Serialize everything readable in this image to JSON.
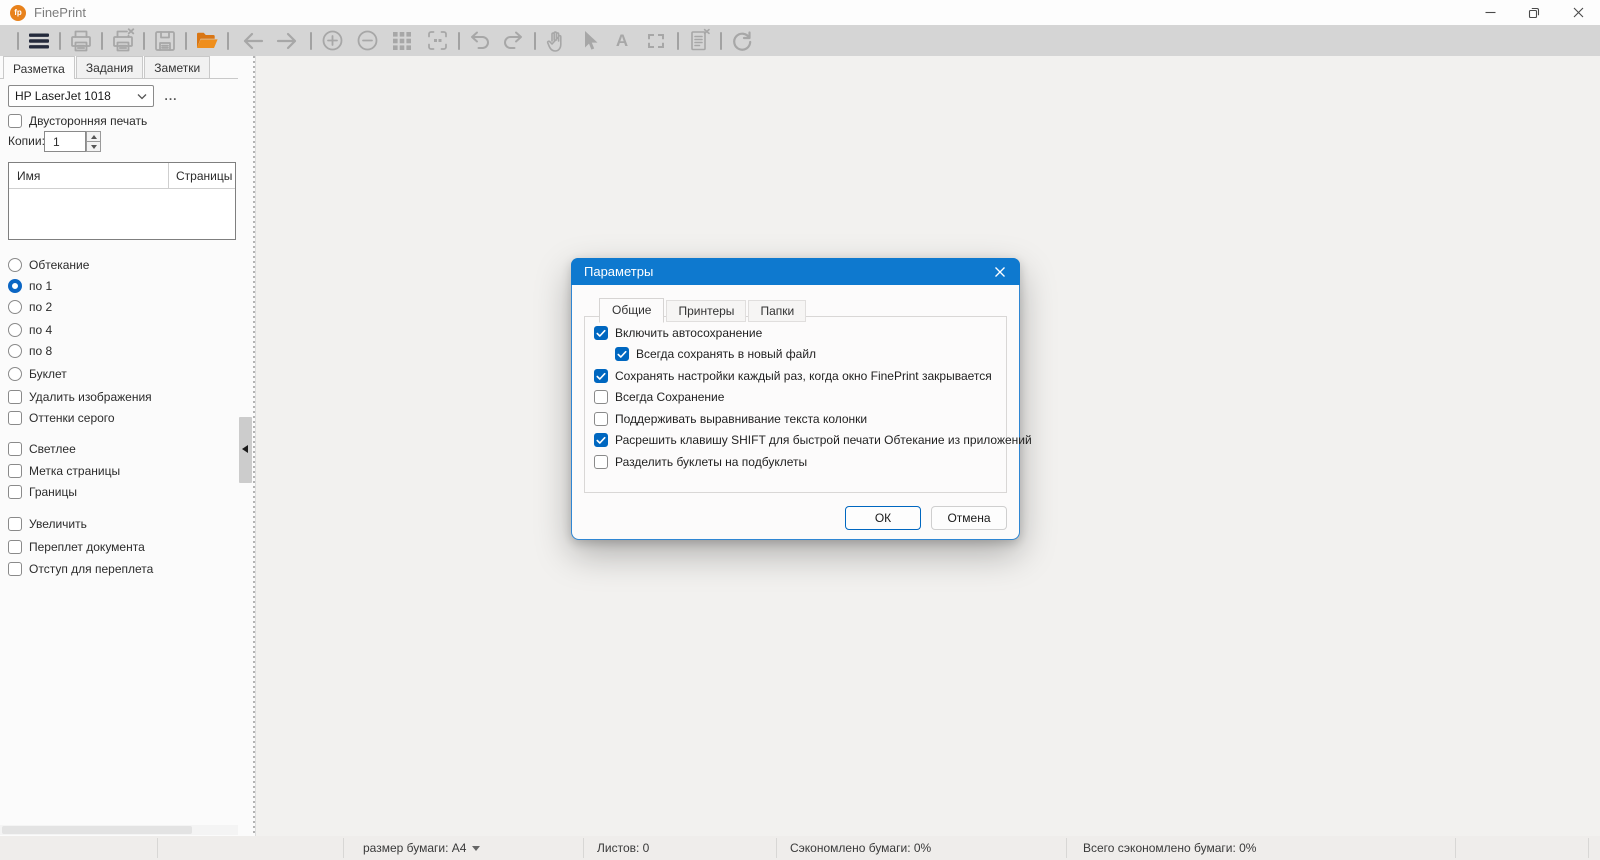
{
  "window": {
    "title": "FinePrint",
    "logo_text": "fp"
  },
  "toolbar": {
    "text_tool_glyph": "A",
    "icons": [
      "menu",
      "print",
      "delete-job",
      "save",
      "open-folder",
      "nav-back",
      "nav-forward",
      "zoom-in",
      "zoom-out",
      "grid-layout",
      "fit-page",
      "undo",
      "redo",
      "hand-pan",
      "cursor-select",
      "text-tool",
      "marquee-select",
      "notes",
      "refresh"
    ]
  },
  "sidebar": {
    "tabs": [
      {
        "label": "Разметка",
        "active": true
      },
      {
        "label": "Задания",
        "active": false
      },
      {
        "label": "Заметки",
        "active": false
      }
    ],
    "printer": {
      "value": "HP LaserJet 1018"
    },
    "more_label": "...",
    "duplex": {
      "label": "Двусторонняя печать",
      "checked": false
    },
    "copies": {
      "label": "Копии:",
      "value": "1"
    },
    "jobs": {
      "columns": [
        "Имя",
        "Страницы"
      ],
      "rows": []
    },
    "layout_options": [
      {
        "label": "Обтекание",
        "selected": false
      },
      {
        "label": "по 1",
        "selected": true
      },
      {
        "label": "по 2",
        "selected": false
      },
      {
        "label": "по 4",
        "selected": false
      },
      {
        "label": "по 8",
        "selected": false
      },
      {
        "label": "Буклет",
        "selected": false
      }
    ],
    "options": [
      {
        "label": "Удалить изображения",
        "checked": false
      },
      {
        "label": "Оттенки серого",
        "checked": false
      },
      {
        "label": "Светлее",
        "checked": false
      },
      {
        "label": "Метка страницы",
        "checked": false
      },
      {
        "label": "Границы",
        "checked": false
      },
      {
        "label": "Увеличить",
        "checked": false
      },
      {
        "label": "Переплет документа",
        "checked": false
      },
      {
        "label": "Отступ для переплета",
        "checked": false
      }
    ]
  },
  "dialog": {
    "title": "Параметры",
    "tabs": [
      {
        "label": "Общие",
        "active": true
      },
      {
        "label": "Принтеры",
        "active": false
      },
      {
        "label": "Папки",
        "active": false
      }
    ],
    "options": [
      {
        "label": "Включить автосохранение",
        "checked": true,
        "indent": 0
      },
      {
        "label": "Всегда сохранять в новый файл",
        "checked": true,
        "indent": 1
      },
      {
        "label": "Сохранять настройки каждый раз, когда окно FinePrint закрывается",
        "checked": true,
        "indent": 0
      },
      {
        "label": "Всегда Сохранение",
        "checked": false,
        "indent": 0
      },
      {
        "label": "Поддерживать выравнивание текста колонки",
        "checked": false,
        "indent": 0
      },
      {
        "label": "Расрешить клавишу SHIFT для быстрой печати Обтекание из приложений",
        "checked": true,
        "indent": 0
      },
      {
        "label": "Разделить буклеты на подбуклеты",
        "checked": false,
        "indent": 0
      }
    ],
    "buttons": {
      "ok": "ОК",
      "cancel": "Отмена"
    }
  },
  "statusbar": {
    "paper_size": "размер бумаги: A4",
    "sheets": "Листов: 0",
    "saved": "Сэкономлено бумаги: 0%",
    "total_saved": "Всего сэкономлено бумаги: 0%"
  },
  "colors": {
    "accent": "#0e79cf",
    "checkbox": "#0067c0",
    "folder": "#e8821c",
    "logo": "#e8821c"
  }
}
